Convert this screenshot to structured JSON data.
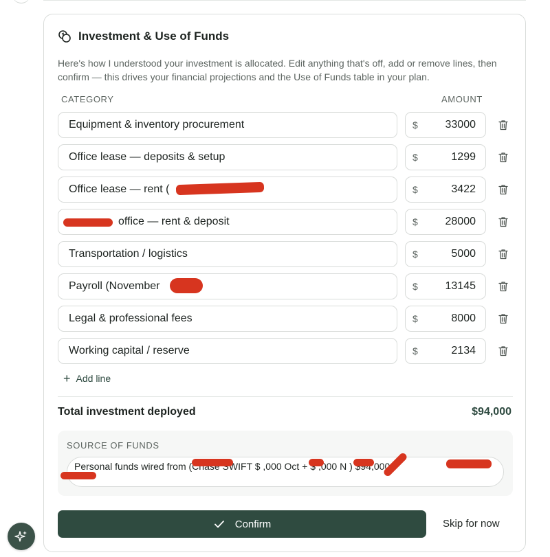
{
  "card": {
    "title": "Investment & Use of Funds",
    "description": "Here's how I understood your investment is allocated. Edit anything that's off, add or remove lines, then confirm — this drives your financial projections and the Use of Funds table in your plan.",
    "column_category": "CATEGORY",
    "column_amount": "AMOUNT",
    "currency_symbol": "$",
    "rows": [
      {
        "category": "Equipment & inventory procurement",
        "amount": "33000"
      },
      {
        "category": "Office lease — deposits & setup",
        "amount": "1299"
      },
      {
        "category": "Office lease — rent (",
        "amount": "3422"
      },
      {
        "category": "office — rent & deposit",
        "amount": "28000"
      },
      {
        "category": "Transportation / logistics",
        "amount": "5000"
      },
      {
        "category": "Payroll (November",
        "amount": "13145"
      },
      {
        "category": "Legal & professional fees",
        "amount": "8000"
      },
      {
        "category": "Working capital / reserve",
        "amount": "2134"
      }
    ],
    "add_line_label": "Add line",
    "total_label": "Total investment deployed",
    "total_value": "$94,000",
    "source_label": "SOURCE OF FUNDS",
    "source_value": "Personal funds wired from (Chase SWIFT $ ,000 Oct + $ ,000 N ) $94,000",
    "confirm_label": "Confirm",
    "skip_label": "Skip for now"
  },
  "colors": {
    "accent": "#2f4b40",
    "redaction": "#d7351f"
  },
  "icons": {
    "header": "coins-icon",
    "row_action": "trash-icon",
    "add": "plus-icon",
    "confirm": "check-icon",
    "assistant": "sparkle-icon"
  }
}
